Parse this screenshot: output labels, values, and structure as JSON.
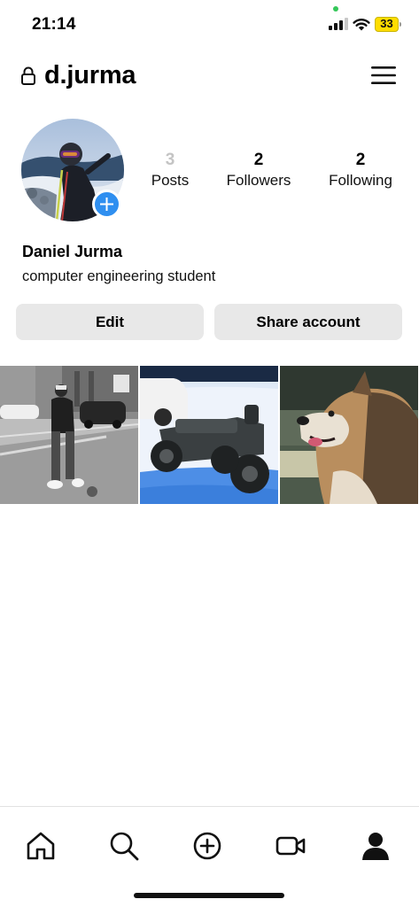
{
  "status_bar": {
    "time": "21:14",
    "battery_level": "33",
    "icons": [
      "signal-icon",
      "wifi-icon",
      "battery-icon"
    ]
  },
  "header": {
    "username": "d.jurma",
    "icons": [
      "lock-icon",
      "hamburger-menu-icon"
    ]
  },
  "profile": {
    "stats": [
      {
        "value": "3",
        "label": "Posts"
      },
      {
        "value": "2",
        "label": "Followers"
      },
      {
        "value": "2",
        "label": "Following"
      }
    ],
    "display_name": "Daniel Jurma",
    "bio": "computer engineering student"
  },
  "actions": {
    "edit_label": "Edit",
    "share_label": "Share account"
  },
  "posts": [
    {
      "subject": "person-standing-on-street-bw"
    },
    {
      "subject": "atv-in-snow"
    },
    {
      "subject": "dog-portrait"
    }
  ],
  "bottom_nav": {
    "items": [
      "home-icon",
      "search-icon",
      "create-icon",
      "reels-icon",
      "profile-icon"
    ],
    "active": "profile-icon"
  },
  "colors": {
    "accent": "#2f8ff0",
    "button_bg": "#e8e8e8",
    "muted_text": "#c4c4c4",
    "battery": "#ffdd00"
  }
}
